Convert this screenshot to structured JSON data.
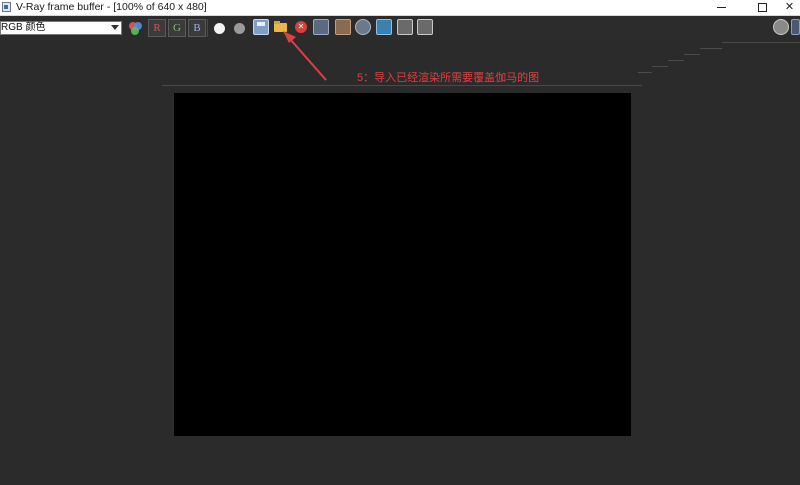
{
  "window": {
    "title": "V-Ray frame buffer - [100% of 640 x 480]",
    "controls": {
      "minimize": "",
      "maximize": "",
      "close": "✕"
    }
  },
  "toolbar": {
    "channel_select": {
      "value": "RGB 颜色"
    },
    "channel_buttons": {
      "r": "R",
      "g": "G",
      "b": "B"
    },
    "icons": [
      "color-channels-icon",
      "white-circle-icon",
      "gray-circle-icon",
      "save-image-icon",
      "load-image-icon",
      "clear-image-icon",
      "region-render-icon",
      "teapot-render-icon",
      "track-mouse-icon",
      "lens-effects-icon",
      "compare-a-icon",
      "compare-b-icon",
      "history-icon"
    ]
  },
  "annotation": {
    "text": "5：导入已经渲染所需要覆盖伽马的图",
    "color": "#e04040"
  },
  "render": {
    "background": "#000000"
  }
}
